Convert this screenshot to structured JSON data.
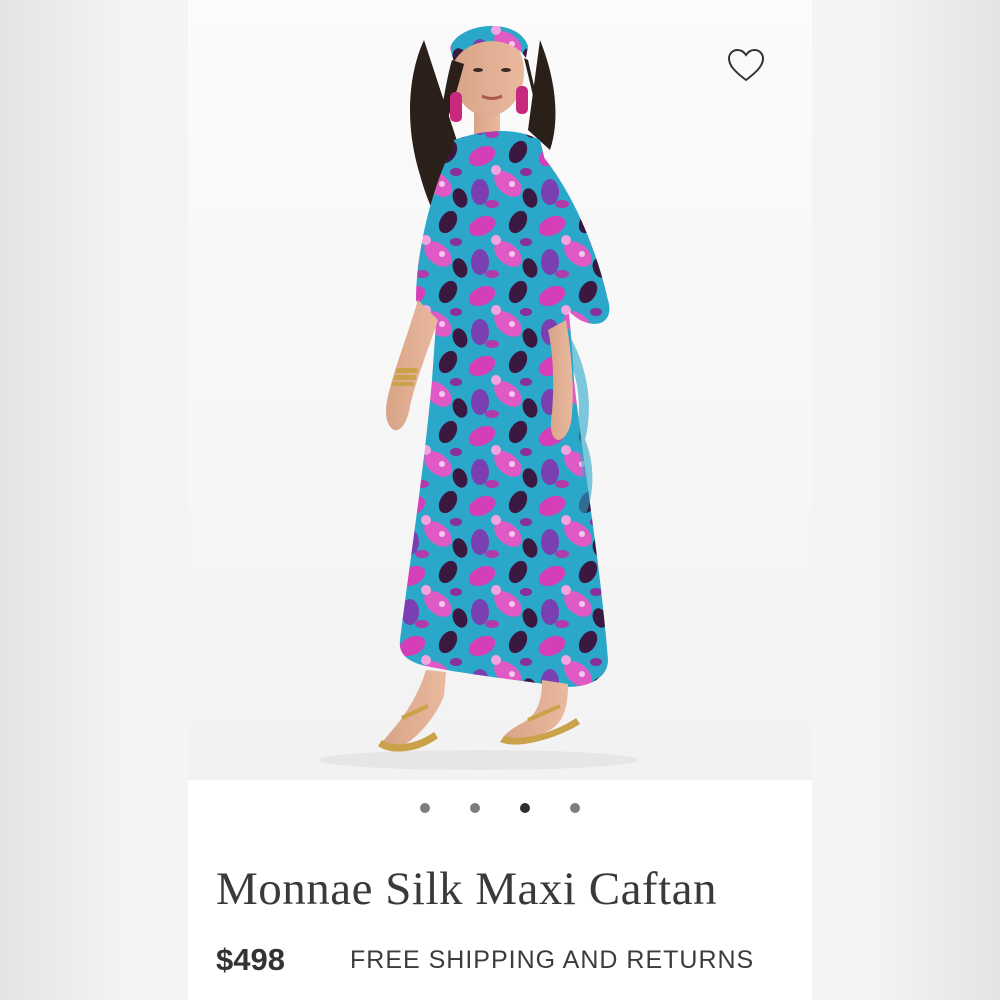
{
  "product": {
    "title": "Monnae Silk Maxi Caftan",
    "price": "$498",
    "shipping_note": "FREE SHIPPING AND RETURNS"
  },
  "gallery": {
    "image_count": 4,
    "active_index": 2
  },
  "icons": {
    "wishlist": "heart-outline-icon"
  },
  "colors": {
    "dot_inactive": "#7d7d7d",
    "dot_active": "#2e2e2e",
    "caftan_base": "#2aa7c9",
    "caftan_pink": "#d43fb7",
    "caftan_purple": "#7a3fb0",
    "caftan_dark": "#3a1840"
  }
}
